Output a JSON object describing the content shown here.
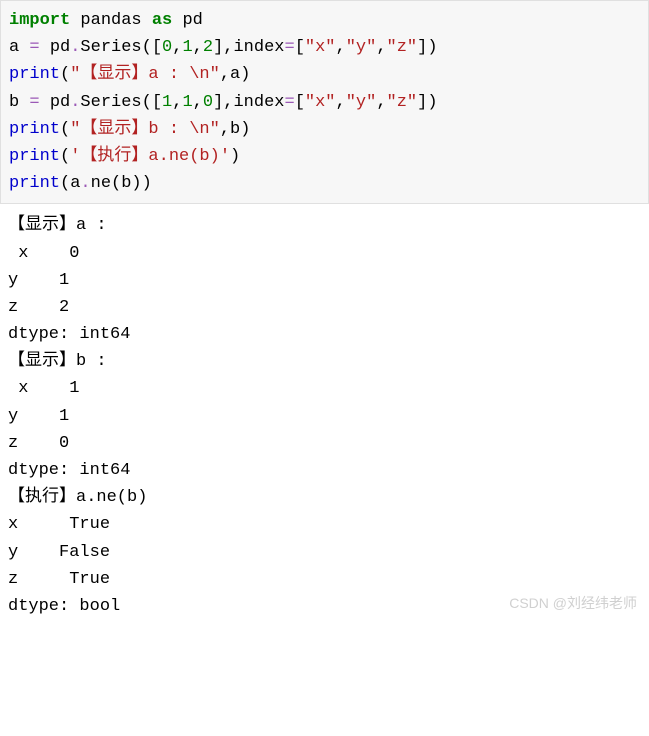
{
  "code": {
    "l1": {
      "kw": "import",
      "mod": " pandas ",
      "as": "as",
      "alias": " pd"
    },
    "l2": {
      "v": "a ",
      "eq": "= ",
      "pd": "pd",
      "dot1": ".",
      "series": "Series",
      "po": "([",
      "n0": "0",
      "c1": ",",
      "n1": "1",
      "c2": ",",
      "n2": "2",
      "pm": "],index",
      "eq2": "=",
      "bo": "[",
      "s0": "\"x\"",
      "c3": ",",
      "s1": "\"y\"",
      "c4": ",",
      "s2": "\"z\"",
      "pc": "])"
    },
    "l3": {
      "fn": "print",
      "po": "(",
      "s": "\"【显示】a : \\n\"",
      "c": ",a)"
    },
    "l4": {
      "v": "b ",
      "eq": "= ",
      "pd": "pd",
      "dot1": ".",
      "series": "Series",
      "po": "([",
      "n0": "1",
      "c1": ",",
      "n1": "1",
      "c2": ",",
      "n2": "0",
      "pm": "],index",
      "eq2": "=",
      "bo": "[",
      "s0": "\"x\"",
      "c3": ",",
      "s1": "\"y\"",
      "c4": ",",
      "s2": "\"z\"",
      "pc": "])"
    },
    "l5": {
      "fn": "print",
      "po": "(",
      "s": "\"【显示】b : \\n\"",
      "c": ",b)"
    },
    "l6": {
      "fn": "print",
      "po": "(",
      "s": "'【执行】a.ne(b)'",
      "c": ")"
    },
    "l7": {
      "fn": "print",
      "po": "(a",
      "dot": ".",
      "m": "ne",
      "pc": "(b))"
    }
  },
  "output": {
    "a_header": "【显示】a :",
    "a_x": " x    0",
    "a_y": "y    1",
    "a_z": "z    2",
    "a_dtype": "dtype: int64",
    "b_header": "【显示】b :",
    "b_x": " x    1",
    "b_y": "y    1",
    "b_z": "z    0",
    "b_dtype": "dtype: int64",
    "e_header": "【执行】a.ne(b)",
    "e_x": "x     True",
    "e_y": "y    False",
    "e_z": "z     True",
    "e_dtype": "dtype: bool"
  },
  "watermark": "CSDN @刘经纬老师",
  "chart_data": {
    "type": "table",
    "series": [
      {
        "name": "a",
        "index": [
          "x",
          "y",
          "z"
        ],
        "values": [
          0,
          1,
          2
        ],
        "dtype": "int64"
      },
      {
        "name": "b",
        "index": [
          "x",
          "y",
          "z"
        ],
        "values": [
          1,
          1,
          0
        ],
        "dtype": "int64"
      },
      {
        "name": "a.ne(b)",
        "index": [
          "x",
          "y",
          "z"
        ],
        "values": [
          true,
          false,
          true
        ],
        "dtype": "bool"
      }
    ]
  }
}
